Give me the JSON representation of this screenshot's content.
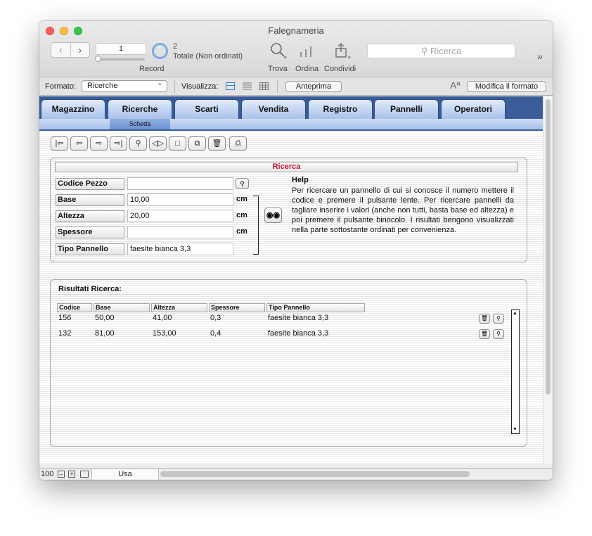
{
  "window": {
    "title": "Falegnameria"
  },
  "toolbar": {
    "nav_back": "‹",
    "nav_forward": "›",
    "record_number": "1",
    "record_label": "Record",
    "found_count": "2",
    "sort_status": "Totale (Non ordinati)",
    "find_label": "Trova",
    "sort_label": "Ordina",
    "share_label": "Condividi",
    "search_placeholder": "Ricerca",
    "more": "»"
  },
  "format_bar": {
    "format_label": "Formato:",
    "layout_value": "Ricerche",
    "view_label": "Visualizza:",
    "preview_button": "Anteprima",
    "text_icon": "Aª",
    "edit_layout_button": "Modifica il formato"
  },
  "tabs": [
    "Magazzino",
    "Ricerche",
    "Scarti",
    "Vendita",
    "Registro",
    "Pannelli",
    "Operatori"
  ],
  "subtab": "Scheda",
  "record_nav_icons": [
    "first-record-icon",
    "prev-record-icon",
    "next-record-icon",
    "last-record-icon",
    "find-icon",
    "sort-icon",
    "new-record-icon",
    "duplicate-icon",
    "delete-icon",
    "print-icon"
  ],
  "search_panel": {
    "title": "Ricerca",
    "fields": [
      {
        "label": "Codice Pezzo",
        "value": "",
        "unit": ""
      },
      {
        "label": "Base",
        "value": "10,00",
        "unit": "cm"
      },
      {
        "label": "Altezza",
        "value": "20,00",
        "unit": "cm"
      },
      {
        "label": "Spessore",
        "value": "",
        "unit": "cm"
      },
      {
        "label": "Tipo Pannello",
        "value": "faesite bianca 3,3",
        "unit": ""
      }
    ],
    "help_title": "Help",
    "help_text": "Per ricercare un pannello di cui si conosce il numero mettere il codice e premere il pulsante lente. Per ricercare pannelli da tagliare inserire i valori (anche non tutti, basta base ed altezza) e poi premere il pulsante binocolo. I risultati bengono visualizzati nella parte sottostante ordinati per convenienza."
  },
  "results": {
    "title": "Risultati Ricerca:",
    "columns": [
      "Codice",
      "Base",
      "Altezza",
      "Spessore",
      "Tipo Pannello"
    ],
    "rows": [
      [
        "156",
        "50,00",
        "41,00",
        "0,3",
        "faesite bianca 3,3"
      ],
      [
        "132",
        "81,00",
        "153,00",
        "0,4",
        "faesite bianca 3,3"
      ]
    ]
  },
  "status_bar": {
    "zoom": "100",
    "mode": "Usa"
  }
}
